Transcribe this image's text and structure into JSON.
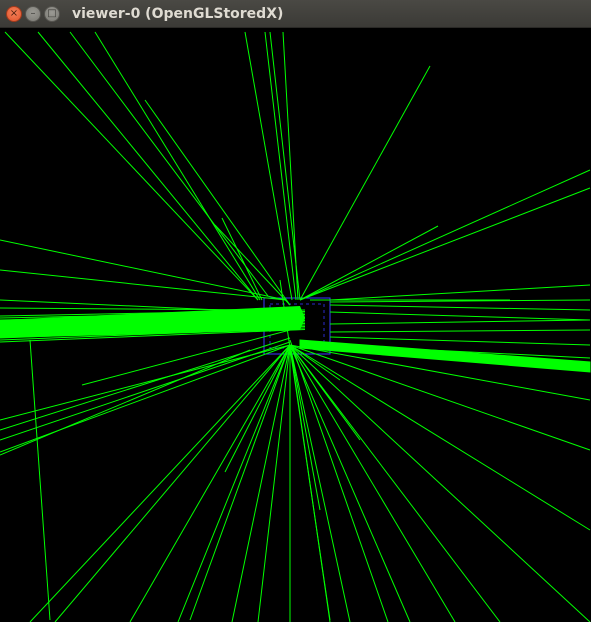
{
  "window": {
    "title": "viewer-0 (OpenGLStoredX)",
    "close_glyph": "×",
    "minimize_glyph": "–",
    "maximize_glyph": "□"
  },
  "colors": {
    "background": "#000000",
    "trajectory": "#00ff00",
    "detector_outline": "#3a3aff",
    "titlebar": "#3c3b37"
  },
  "icons": [
    "close-icon",
    "minimize-icon",
    "maximize-icon"
  ]
}
